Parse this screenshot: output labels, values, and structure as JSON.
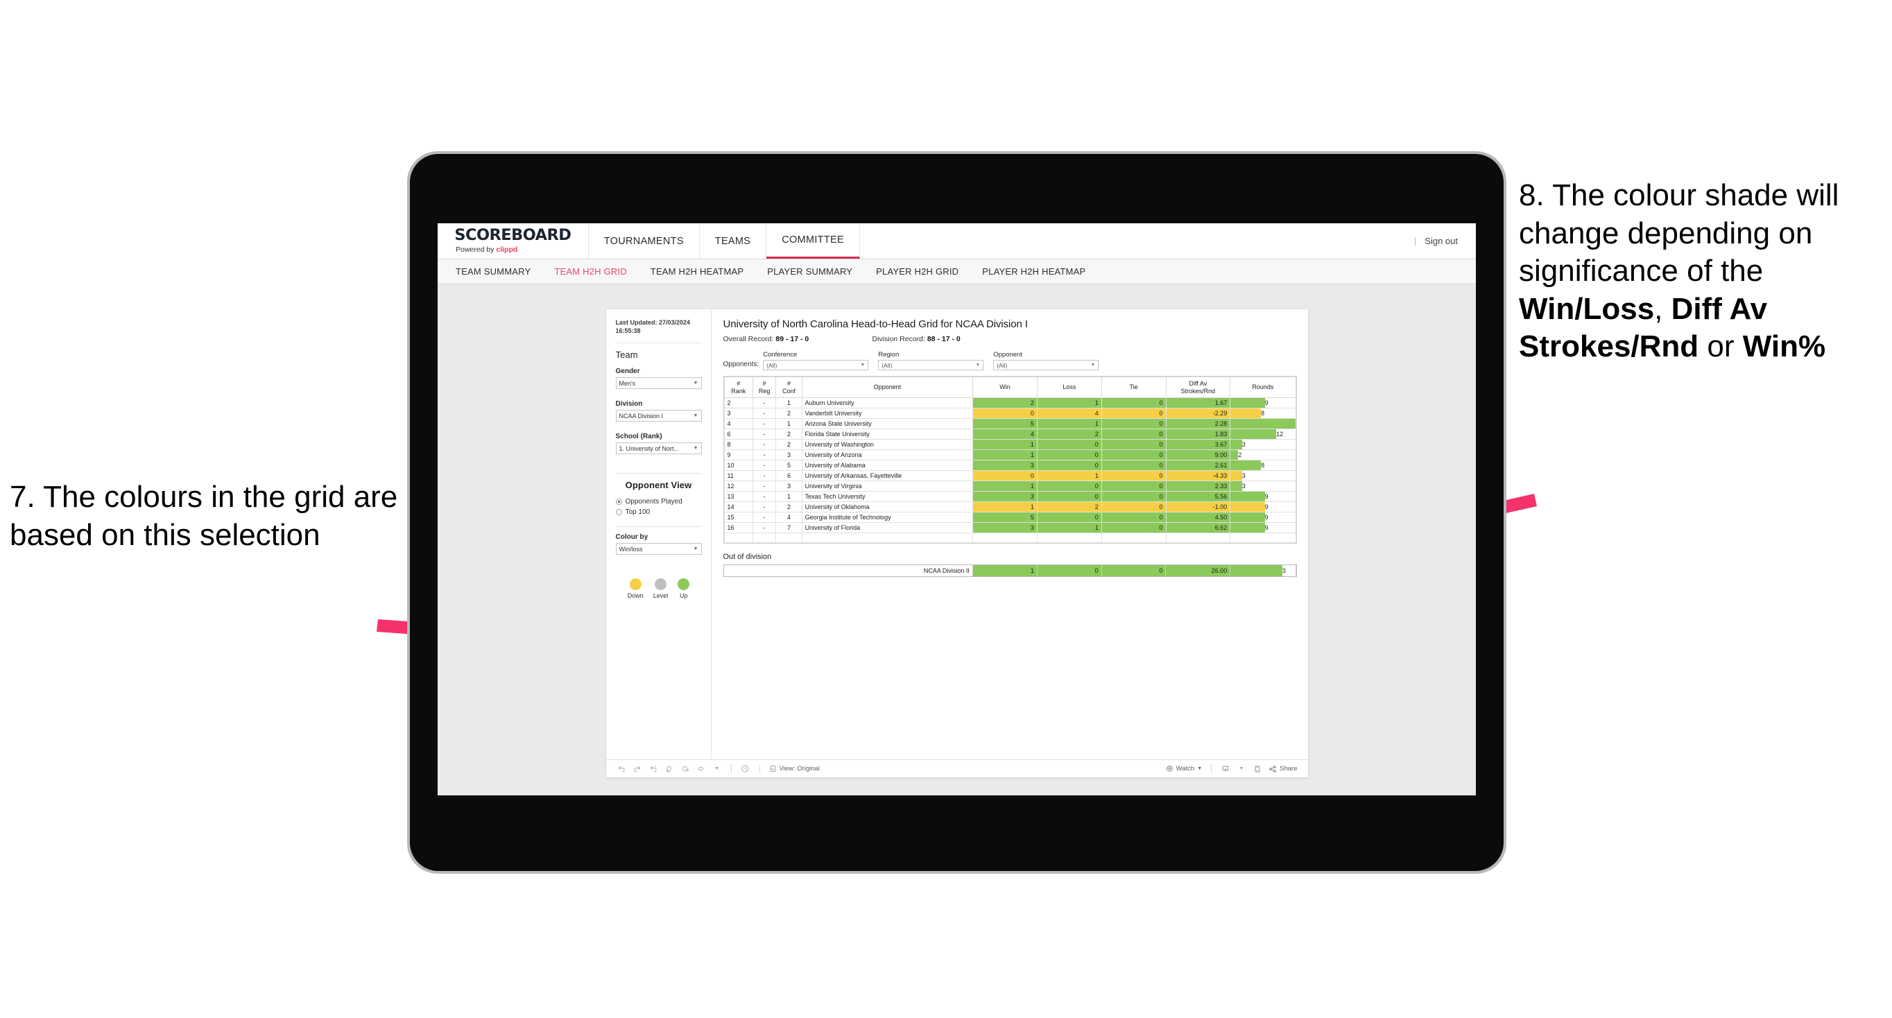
{
  "annotations": {
    "left": {
      "text": "7. The colours in the grid are based on this selection"
    },
    "right": {
      "part1": "8. The colour shade will change depending on significance of the ",
      "bold1": "Win/Loss",
      "mid1": ", ",
      "bold2": "Diff Av Strokes/Rnd",
      "mid2": " or ",
      "bold3": "Win%"
    },
    "arrow_color": "#f5326b"
  },
  "header": {
    "brand_title": "SCOREBOARD",
    "brand_sub_prefix": "Powered by ",
    "brand_sub_name": "clippd",
    "nav": [
      {
        "label": "TOURNAMENTS",
        "active": false
      },
      {
        "label": "TEAMS",
        "active": false
      },
      {
        "label": "COMMITTEE",
        "active": true
      }
    ],
    "divider": "|",
    "sign_out": "Sign out"
  },
  "subnav": [
    {
      "label": "TEAM SUMMARY",
      "active": false
    },
    {
      "label": "TEAM H2H GRID",
      "active": true
    },
    {
      "label": "TEAM H2H HEATMAP",
      "active": false
    },
    {
      "label": "PLAYER SUMMARY",
      "active": false
    },
    {
      "label": "PLAYER H2H GRID",
      "active": false
    },
    {
      "label": "PLAYER H2H HEATMAP",
      "active": false
    }
  ],
  "sidebar": {
    "last_updated": "Last Updated: 27/03/2024 16:55:38",
    "team_heading": "Team",
    "gender_label": "Gender",
    "gender_value": "Men's",
    "division_label": "Division",
    "division_value": "NCAA Division I",
    "school_label": "School (Rank)",
    "school_value": "1. University of Nort...",
    "opponent_view_heading": "Opponent View",
    "radio_options": [
      {
        "label": "Opponents Played",
        "selected": true
      },
      {
        "label": "Top 100",
        "selected": false
      }
    ],
    "colour_by_label": "Colour by",
    "colour_by_value": "Win/loss",
    "legend": [
      {
        "label": "Down",
        "color": "#f5d046"
      },
      {
        "label": "Level",
        "color": "#bfbfbf"
      },
      {
        "label": "Up",
        "color": "#8bc95a"
      }
    ]
  },
  "viz": {
    "title": "University of North Carolina Head-to-Head Grid for NCAA Division I",
    "overall_record_label": "Overall Record: ",
    "overall_record_value": "89 - 17 - 0",
    "division_record_label": "Division Record: ",
    "division_record_value": "88 - 17 - 0",
    "opponents_label": "Opponents:",
    "filters": [
      {
        "label": "Conference",
        "value": "(All)"
      },
      {
        "label": "Region",
        "value": "(All)"
      },
      {
        "label": "Opponent",
        "value": "(All)"
      }
    ],
    "columns": [
      "# Rank",
      "# Reg",
      "# Conf",
      "Opponent",
      "Win",
      "Loss",
      "Tie",
      "Diff Av Strokes/Rnd",
      "Rounds"
    ],
    "columns_split": [
      {
        "l1": "#",
        "l2": "Rank"
      },
      {
        "l1": "#",
        "l2": "Reg"
      },
      {
        "l1": "#",
        "l2": "Conf"
      },
      {
        "l1": "Opponent",
        "l2": ""
      },
      {
        "l1": "Win",
        "l2": ""
      },
      {
        "l1": "Loss",
        "l2": ""
      },
      {
        "l1": "Tie",
        "l2": ""
      },
      {
        "l1": "Diff Av",
        "l2": "Strokes/Rnd"
      },
      {
        "l1": "Rounds",
        "l2": ""
      }
    ],
    "rows": [
      {
        "rank": "2",
        "reg": "-",
        "conf": "1",
        "opponent": "Auburn University",
        "win": "2",
        "loss": "1",
        "tie": "0",
        "diff": "1.67",
        "rounds": "9",
        "color": "#8bc95a"
      },
      {
        "rank": "3",
        "reg": "-",
        "conf": "2",
        "opponent": "Vanderbilt University",
        "win": "0",
        "loss": "4",
        "tie": "0",
        "diff": "-2.29",
        "rounds": "8",
        "color": "#f5d046"
      },
      {
        "rank": "4",
        "reg": "-",
        "conf": "1",
        "opponent": "Arizona State University",
        "win": "5",
        "loss": "1",
        "tie": "0",
        "diff": "2.28",
        "rounds": "17",
        "color": "#8bc95a"
      },
      {
        "rank": "6",
        "reg": "-",
        "conf": "2",
        "opponent": "Florida State University",
        "win": "4",
        "loss": "2",
        "tie": "0",
        "diff": "1.83",
        "rounds": "12",
        "color": "#8bc95a"
      },
      {
        "rank": "8",
        "reg": "-",
        "conf": "2",
        "opponent": "University of Washington",
        "win": "1",
        "loss": "0",
        "tie": "0",
        "diff": "3.67",
        "rounds": "3",
        "color": "#8bc95a"
      },
      {
        "rank": "9",
        "reg": "-",
        "conf": "3",
        "opponent": "University of Arizona",
        "win": "1",
        "loss": "0",
        "tie": "0",
        "diff": "9.00",
        "rounds": "2",
        "color": "#8bc95a"
      },
      {
        "rank": "10",
        "reg": "-",
        "conf": "5",
        "opponent": "University of Alabama",
        "win": "3",
        "loss": "0",
        "tie": "0",
        "diff": "2.61",
        "rounds": "8",
        "color": "#8bc95a"
      },
      {
        "rank": "11",
        "reg": "-",
        "conf": "6",
        "opponent": "University of Arkansas, Fayetteville",
        "win": "0",
        "loss": "1",
        "tie": "0",
        "diff": "-4.33",
        "rounds": "3",
        "color": "#f5d046"
      },
      {
        "rank": "12",
        "reg": "-",
        "conf": "3",
        "opponent": "University of Virginia",
        "win": "1",
        "loss": "0",
        "tie": "0",
        "diff": "2.33",
        "rounds": "3",
        "color": "#8bc95a"
      },
      {
        "rank": "13",
        "reg": "-",
        "conf": "1",
        "opponent": "Texas Tech University",
        "win": "3",
        "loss": "0",
        "tie": "0",
        "diff": "5.56",
        "rounds": "9",
        "color": "#8bc95a"
      },
      {
        "rank": "14",
        "reg": "-",
        "conf": "2",
        "opponent": "University of Oklahoma",
        "win": "1",
        "loss": "2",
        "tie": "0",
        "diff": "-1.00",
        "rounds": "9",
        "color": "#f5d046"
      },
      {
        "rank": "15",
        "reg": "-",
        "conf": "4",
        "opponent": "Georgia Institute of Technology",
        "win": "5",
        "loss": "0",
        "tie": "0",
        "diff": "4.50",
        "rounds": "9",
        "color": "#8bc95a"
      },
      {
        "rank": "16",
        "reg": "-",
        "conf": "7",
        "opponent": "University of Florida",
        "win": "3",
        "loss": "1",
        "tie": "0",
        "diff": "6.62",
        "rounds": "9",
        "color": "#8bc95a"
      }
    ],
    "out_of_division_title": "Out of division",
    "out_of_division_row": {
      "label": "NCAA Division II",
      "win": "1",
      "loss": "0",
      "tie": "0",
      "diff": "26.00",
      "rounds": "3",
      "color": "#8bc95a"
    }
  },
  "toolbar": {
    "view_label": "View: Original",
    "watch_label": "Watch",
    "share_label": "Share",
    "icons": [
      "undo-icon",
      "redo-icon",
      "revert-icon",
      "refresh-icon",
      "pause-icon",
      "rectangle-select-icon",
      "clock-icon",
      "view-original-icon",
      "watch-icon",
      "download-icon",
      "fullscreen-icon",
      "share-icon"
    ]
  },
  "chart_data": {
    "type": "table",
    "title": "University of North Carolina Head-to-Head Grid for NCAA Division I",
    "columns": [
      "# Rank",
      "# Reg",
      "# Conf",
      "Opponent",
      "Win",
      "Loss",
      "Tie",
      "Diff Av Strokes/Rnd",
      "Rounds"
    ],
    "rows": [
      [
        "2",
        "-",
        "1",
        "Auburn University",
        2,
        1,
        0,
        1.67,
        9
      ],
      [
        "3",
        "-",
        "2",
        "Vanderbilt University",
        0,
        4,
        0,
        -2.29,
        8
      ],
      [
        "4",
        "-",
        "1",
        "Arizona State University",
        5,
        1,
        0,
        2.28,
        17
      ],
      [
        "6",
        "-",
        "2",
        "Florida State University",
        4,
        2,
        0,
        1.83,
        12
      ],
      [
        "8",
        "-",
        "2",
        "University of Washington",
        1,
        0,
        0,
        3.67,
        3
      ],
      [
        "9",
        "-",
        "3",
        "University of Arizona",
        1,
        0,
        0,
        9.0,
        2
      ],
      [
        "10",
        "-",
        "5",
        "University of Alabama",
        3,
        0,
        0,
        2.61,
        8
      ],
      [
        "11",
        "-",
        "6",
        "University of Arkansas, Fayetteville",
        0,
        1,
        0,
        -4.33,
        3
      ],
      [
        "12",
        "-",
        "3",
        "University of Virginia",
        1,
        0,
        0,
        2.33,
        3
      ],
      [
        "13",
        "-",
        "1",
        "Texas Tech University",
        3,
        0,
        0,
        5.56,
        9
      ],
      [
        "14",
        "-",
        "2",
        "University of Oklahoma",
        1,
        2,
        0,
        -1.0,
        9
      ],
      [
        "15",
        "-",
        "4",
        "Georgia Institute of Technology",
        5,
        0,
        0,
        4.5,
        9
      ],
      [
        "16",
        "-",
        "7",
        "University of Florida",
        3,
        1,
        0,
        6.62,
        9
      ]
    ],
    "out_of_division": [
      [
        "NCAA Division II",
        1,
        0,
        0,
        26.0,
        3
      ]
    ],
    "colour_by": "Win/loss",
    "legend": [
      {
        "label": "Down",
        "color": "#f5d046"
      },
      {
        "label": "Level",
        "color": "#bfbfbf"
      },
      {
        "label": "Up",
        "color": "#8bc95a"
      }
    ],
    "rounds_max": 17
  }
}
